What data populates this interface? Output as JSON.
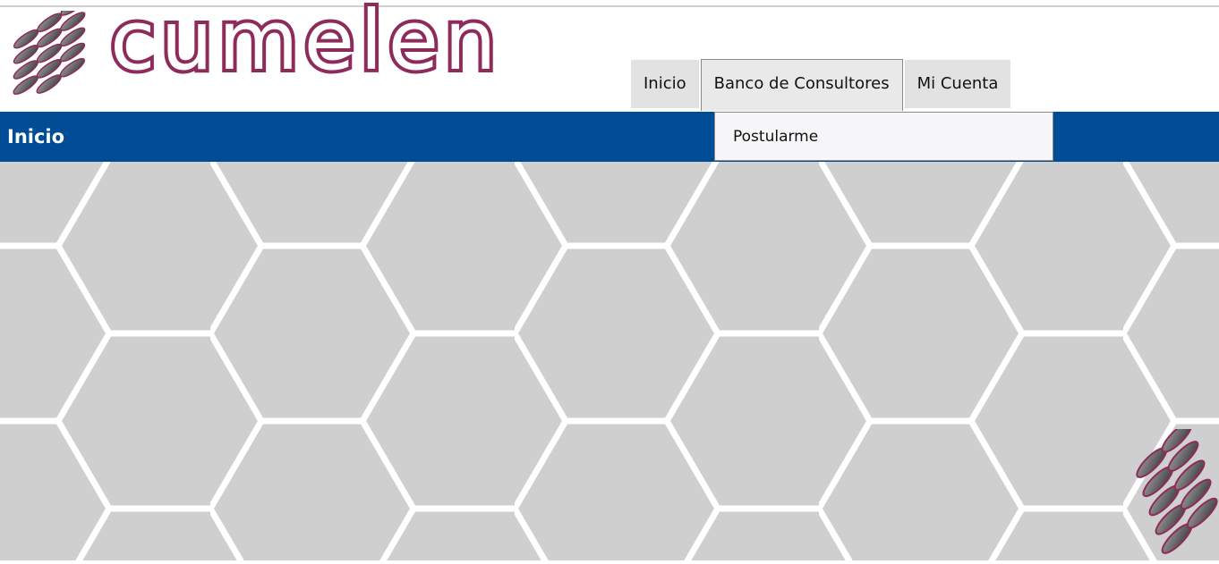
{
  "brand": {
    "logo_text": "cumelen",
    "logo_icon": "scale-pattern-icon",
    "accent_color": "#8e2b5b"
  },
  "nav": {
    "items": [
      {
        "label": "Inicio"
      },
      {
        "label": "Banco de Consultores"
      },
      {
        "label": "Mi Cuenta"
      }
    ]
  },
  "dropdown": {
    "items": [
      {
        "label": "Postularme"
      }
    ]
  },
  "page": {
    "title": "Inicio"
  },
  "colors": {
    "header_bar": "#004d96",
    "background_hex": "#cfcfcf",
    "hex_lines": "#ffffff"
  }
}
